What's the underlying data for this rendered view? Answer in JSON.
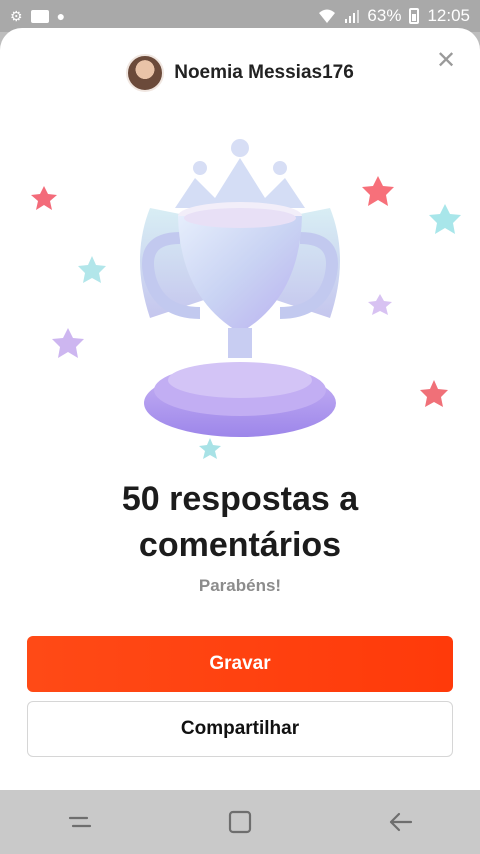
{
  "status_bar": {
    "battery": "63%",
    "time": "12:05"
  },
  "header": {
    "username": "Noemia Messias176"
  },
  "achievement": {
    "title": "50 respostas a comentários",
    "subtitle": "Parabéns!"
  },
  "actions": {
    "primary_label": "Gravar",
    "secondary_label": "Compartilhar"
  },
  "colors": {
    "primary": "#ff3a0a",
    "background": "#ffffff"
  }
}
